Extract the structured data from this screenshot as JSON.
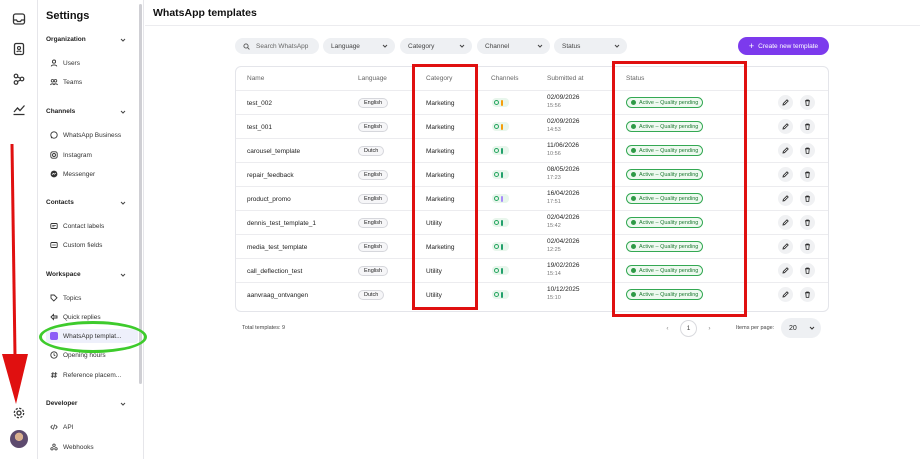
{
  "rail": {
    "icons": [
      "inbox-icon",
      "contacts-book-icon",
      "share-nodes-icon",
      "analytics-icon",
      "settings-gear-icon"
    ]
  },
  "sidebar": {
    "title": "Settings",
    "sections": [
      {
        "label": "Organization",
        "items": [
          {
            "label": "Users",
            "icon": "user-icon"
          },
          {
            "label": "Teams",
            "icon": "team-icon"
          }
        ]
      },
      {
        "label": "Channels",
        "items": [
          {
            "label": "WhatsApp Business",
            "icon": "whatsapp-icon"
          },
          {
            "label": "Instagram",
            "icon": "instagram-icon"
          },
          {
            "label": "Messenger",
            "icon": "messenger-icon"
          }
        ]
      },
      {
        "label": "Contacts",
        "items": [
          {
            "label": "Contact labels",
            "icon": "label-icon"
          },
          {
            "label": "Custom fields",
            "icon": "custom-fields-icon"
          }
        ]
      },
      {
        "label": "Workspace",
        "items": [
          {
            "label": "Topics",
            "icon": "tag-icon"
          },
          {
            "label": "Quick replies",
            "icon": "quick-reply-icon"
          },
          {
            "label": "WhatsApp templat...",
            "icon": "template-icon",
            "active": true
          },
          {
            "label": "Opening hours",
            "icon": "clock-icon"
          },
          {
            "label": "Reference placem...",
            "icon": "hash-icon"
          }
        ]
      },
      {
        "label": "Developer",
        "items": [
          {
            "label": "API",
            "icon": "code-icon"
          },
          {
            "label": "Webhooks",
            "icon": "webhook-icon"
          }
        ]
      }
    ]
  },
  "page": {
    "title": "WhatsApp templates",
    "search_placeholder": "Search WhatsApp",
    "filters": [
      "Language",
      "Category",
      "Channel",
      "Status"
    ],
    "create_button": "Create new template"
  },
  "table": {
    "headers": [
      "Name",
      "Language",
      "Category",
      "Channels",
      "Submitted at",
      "Status"
    ],
    "rows": [
      {
        "name": "test_002",
        "language": "English",
        "category": "Marketing",
        "channel_color": "#f59e0b",
        "date": "02/09/2026",
        "time": "15:56",
        "status": "Active – Quality pending"
      },
      {
        "name": "test_001",
        "language": "English",
        "category": "Marketing",
        "channel_color": "#f59e0b",
        "date": "02/09/2026",
        "time": "14:53",
        "status": "Active – Quality pending"
      },
      {
        "name": "carousel_template",
        "language": "Dutch",
        "category": "Marketing",
        "channel_color": "#22a06b",
        "date": "11/06/2026",
        "time": "10:56",
        "status": "Active – Quality pending"
      },
      {
        "name": "repair_feedback",
        "language": "English",
        "category": "Marketing",
        "channel_color": "#22a06b",
        "date": "08/05/2026",
        "time": "17:23",
        "status": "Active – Quality pending"
      },
      {
        "name": "product_promo",
        "language": "English",
        "category": "Marketing",
        "channel_color": "#a78bfa",
        "date": "16/04/2026",
        "time": "17:51",
        "status": "Active – Quality pending"
      },
      {
        "name": "dennis_test_template_1",
        "language": "English",
        "category": "Utility",
        "channel_color": "#22a06b",
        "date": "02/04/2026",
        "time": "15:42",
        "status": "Active – Quality pending"
      },
      {
        "name": "media_test_template",
        "language": "English",
        "category": "Marketing",
        "channel_color": "#22a06b",
        "date": "02/04/2026",
        "time": "12:25",
        "status": "Active – Quality pending"
      },
      {
        "name": "call_deflection_test",
        "language": "English",
        "category": "Utility",
        "channel_color": "#22a06b",
        "date": "19/02/2026",
        "time": "15:14",
        "status": "Active – Quality pending"
      },
      {
        "name": "aanvraag_ontvangen",
        "language": "Dutch",
        "category": "Utility",
        "channel_color": "#22a06b",
        "date": "10/12/2025",
        "time": "15:10",
        "status": "Active – Quality pending"
      }
    ]
  },
  "footer": {
    "total_label": "Total templates: 9",
    "current_page": "1",
    "items_per_page_label": "Items per page:",
    "items_per_page_value": "20"
  },
  "colors": {
    "accent": "#7c3aed",
    "status_green": "#1f7a33",
    "annotation_red": "#e01010",
    "annotation_green": "#3ecb2c"
  }
}
